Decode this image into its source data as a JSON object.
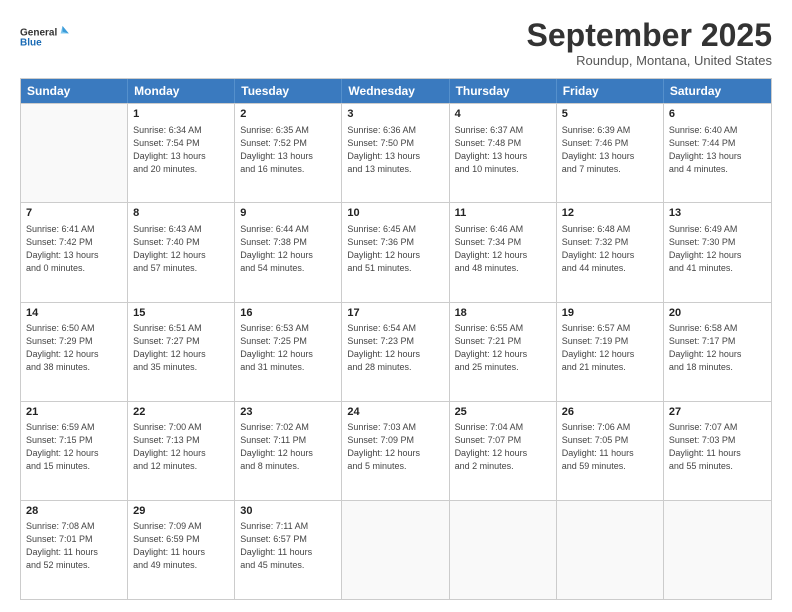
{
  "logo": {
    "line1": "General",
    "line2": "Blue"
  },
  "header": {
    "month": "September 2025",
    "location": "Roundup, Montana, United States"
  },
  "days_of_week": [
    "Sunday",
    "Monday",
    "Tuesday",
    "Wednesday",
    "Thursday",
    "Friday",
    "Saturday"
  ],
  "weeks": [
    [
      {
        "day": "",
        "info": ""
      },
      {
        "day": "1",
        "info": "Sunrise: 6:34 AM\nSunset: 7:54 PM\nDaylight: 13 hours\nand 20 minutes."
      },
      {
        "day": "2",
        "info": "Sunrise: 6:35 AM\nSunset: 7:52 PM\nDaylight: 13 hours\nand 16 minutes."
      },
      {
        "day": "3",
        "info": "Sunrise: 6:36 AM\nSunset: 7:50 PM\nDaylight: 13 hours\nand 13 minutes."
      },
      {
        "day": "4",
        "info": "Sunrise: 6:37 AM\nSunset: 7:48 PM\nDaylight: 13 hours\nand 10 minutes."
      },
      {
        "day": "5",
        "info": "Sunrise: 6:39 AM\nSunset: 7:46 PM\nDaylight: 13 hours\nand 7 minutes."
      },
      {
        "day": "6",
        "info": "Sunrise: 6:40 AM\nSunset: 7:44 PM\nDaylight: 13 hours\nand 4 minutes."
      }
    ],
    [
      {
        "day": "7",
        "info": "Sunrise: 6:41 AM\nSunset: 7:42 PM\nDaylight: 13 hours\nand 0 minutes."
      },
      {
        "day": "8",
        "info": "Sunrise: 6:43 AM\nSunset: 7:40 PM\nDaylight: 12 hours\nand 57 minutes."
      },
      {
        "day": "9",
        "info": "Sunrise: 6:44 AM\nSunset: 7:38 PM\nDaylight: 12 hours\nand 54 minutes."
      },
      {
        "day": "10",
        "info": "Sunrise: 6:45 AM\nSunset: 7:36 PM\nDaylight: 12 hours\nand 51 minutes."
      },
      {
        "day": "11",
        "info": "Sunrise: 6:46 AM\nSunset: 7:34 PM\nDaylight: 12 hours\nand 48 minutes."
      },
      {
        "day": "12",
        "info": "Sunrise: 6:48 AM\nSunset: 7:32 PM\nDaylight: 12 hours\nand 44 minutes."
      },
      {
        "day": "13",
        "info": "Sunrise: 6:49 AM\nSunset: 7:30 PM\nDaylight: 12 hours\nand 41 minutes."
      }
    ],
    [
      {
        "day": "14",
        "info": "Sunrise: 6:50 AM\nSunset: 7:29 PM\nDaylight: 12 hours\nand 38 minutes."
      },
      {
        "day": "15",
        "info": "Sunrise: 6:51 AM\nSunset: 7:27 PM\nDaylight: 12 hours\nand 35 minutes."
      },
      {
        "day": "16",
        "info": "Sunrise: 6:53 AM\nSunset: 7:25 PM\nDaylight: 12 hours\nand 31 minutes."
      },
      {
        "day": "17",
        "info": "Sunrise: 6:54 AM\nSunset: 7:23 PM\nDaylight: 12 hours\nand 28 minutes."
      },
      {
        "day": "18",
        "info": "Sunrise: 6:55 AM\nSunset: 7:21 PM\nDaylight: 12 hours\nand 25 minutes."
      },
      {
        "day": "19",
        "info": "Sunrise: 6:57 AM\nSunset: 7:19 PM\nDaylight: 12 hours\nand 21 minutes."
      },
      {
        "day": "20",
        "info": "Sunrise: 6:58 AM\nSunset: 7:17 PM\nDaylight: 12 hours\nand 18 minutes."
      }
    ],
    [
      {
        "day": "21",
        "info": "Sunrise: 6:59 AM\nSunset: 7:15 PM\nDaylight: 12 hours\nand 15 minutes."
      },
      {
        "day": "22",
        "info": "Sunrise: 7:00 AM\nSunset: 7:13 PM\nDaylight: 12 hours\nand 12 minutes."
      },
      {
        "day": "23",
        "info": "Sunrise: 7:02 AM\nSunset: 7:11 PM\nDaylight: 12 hours\nand 8 minutes."
      },
      {
        "day": "24",
        "info": "Sunrise: 7:03 AM\nSunset: 7:09 PM\nDaylight: 12 hours\nand 5 minutes."
      },
      {
        "day": "25",
        "info": "Sunrise: 7:04 AM\nSunset: 7:07 PM\nDaylight: 12 hours\nand 2 minutes."
      },
      {
        "day": "26",
        "info": "Sunrise: 7:06 AM\nSunset: 7:05 PM\nDaylight: 11 hours\nand 59 minutes."
      },
      {
        "day": "27",
        "info": "Sunrise: 7:07 AM\nSunset: 7:03 PM\nDaylight: 11 hours\nand 55 minutes."
      }
    ],
    [
      {
        "day": "28",
        "info": "Sunrise: 7:08 AM\nSunset: 7:01 PM\nDaylight: 11 hours\nand 52 minutes."
      },
      {
        "day": "29",
        "info": "Sunrise: 7:09 AM\nSunset: 6:59 PM\nDaylight: 11 hours\nand 49 minutes."
      },
      {
        "day": "30",
        "info": "Sunrise: 7:11 AM\nSunset: 6:57 PM\nDaylight: 11 hours\nand 45 minutes."
      },
      {
        "day": "",
        "info": ""
      },
      {
        "day": "",
        "info": ""
      },
      {
        "day": "",
        "info": ""
      },
      {
        "day": "",
        "info": ""
      }
    ]
  ]
}
